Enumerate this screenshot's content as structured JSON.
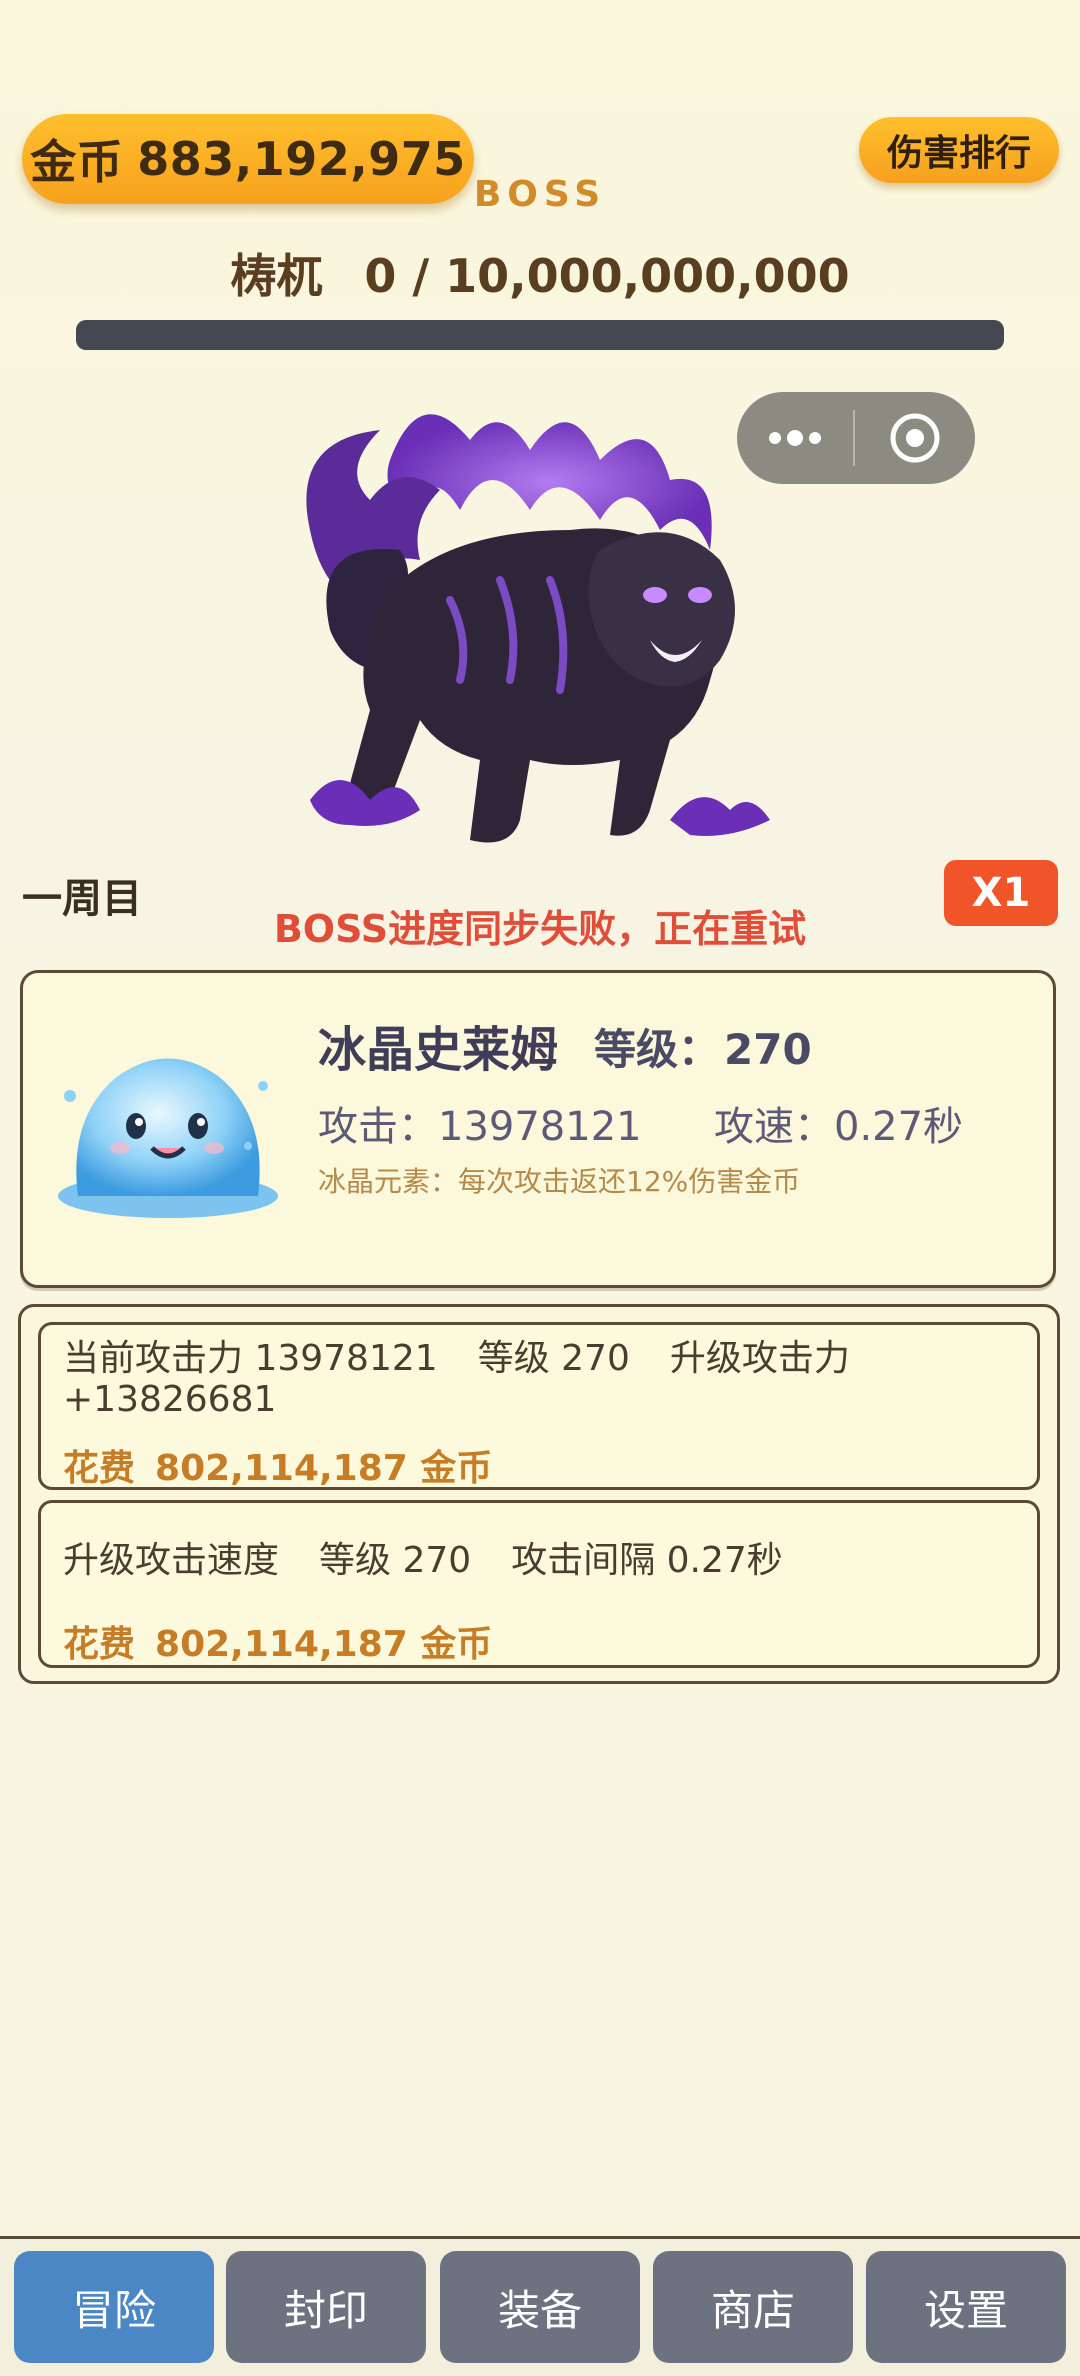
{
  "header": {
    "coin_label": "金币",
    "coin_value": "883,192,975",
    "rank_button": "伤害排行"
  },
  "boss": {
    "label": "BOSS",
    "name": "梼杌",
    "hp_text": "0 / 10,000,000,000",
    "hp_fraction": 0.0,
    "lap": "一周目",
    "status_message": "BOSS进度同步失败，正在重试"
  },
  "speed_button": "X1",
  "hero": {
    "name": "冰晶史莱姆",
    "level_label": "等级：",
    "level_value": "270",
    "attack": "攻击：13978121",
    "attack_speed": "攻速：0.27秒",
    "skill": "冰晶元素：每次攻击返还12%伤害金币"
  },
  "upgrades": {
    "attack": {
      "line1_a": "当前攻击力 13978121",
      "line1_b": "等级 270",
      "line1_c": "升级攻击力",
      "line2": "+13826681",
      "cost_label": "花费",
      "cost_value": "802,114,187 金币"
    },
    "speed": {
      "line1_a": "升级攻击速度",
      "line1_b": "等级 270",
      "line1_c": "攻击间隔 0.27秒",
      "cost_label": "花费",
      "cost_value": "802,114,187 金币"
    }
  },
  "nav": {
    "items": [
      {
        "label": "冒险"
      },
      {
        "label": "封印"
      },
      {
        "label": "装备"
      },
      {
        "label": "商店"
      },
      {
        "label": "设置"
      }
    ],
    "active_index": 0
  },
  "colors": {
    "coin_pill": "#f7a11d",
    "status_text": "#e04e3a",
    "speed_button": "#f2542a",
    "nav_active": "#4b86c5",
    "nav_inactive": "#6c7280",
    "cost_text": "#c77d25"
  }
}
